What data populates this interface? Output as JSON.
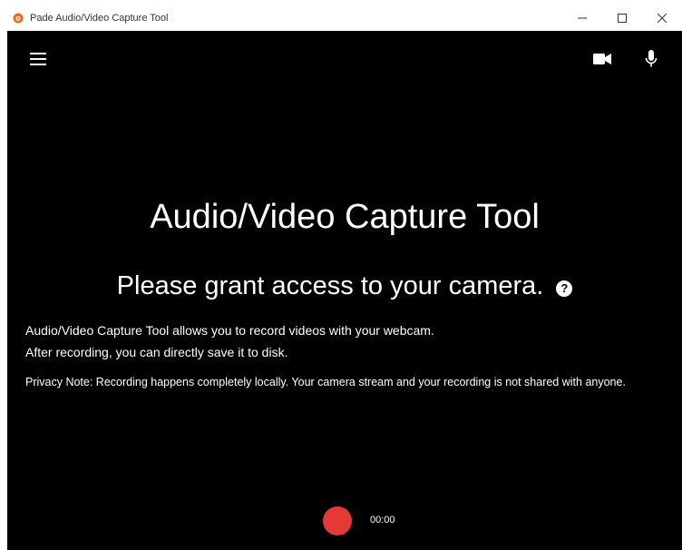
{
  "window": {
    "title": "Pade Audio/Video Capture Tool",
    "minimize_icon": "minimize-icon",
    "maximize_icon": "maximize-icon",
    "close_icon": "close-icon"
  },
  "toolbar": {
    "menu_icon": "hamburger-menu-icon",
    "camera_icon": "video-camera-icon",
    "mic_icon": "microphone-icon"
  },
  "main": {
    "title": "Audio/Video Capture Tool",
    "access_prompt": "Please grant access to your camera.",
    "help_glyph": "?",
    "description_lines": [
      "Audio/Video Capture Tool allows you to record videos with your webcam.",
      "After recording, you can directly save it to disk."
    ],
    "privacy_note": "Privacy Note: Recording happens completely locally. Your camera stream and your recording is not shared with anyone."
  },
  "recorder": {
    "timer": "00:00"
  },
  "colors": {
    "background": "#000000",
    "record_button": "#e53935",
    "text": "#ffffff",
    "app_icon": "#f26b1d"
  }
}
